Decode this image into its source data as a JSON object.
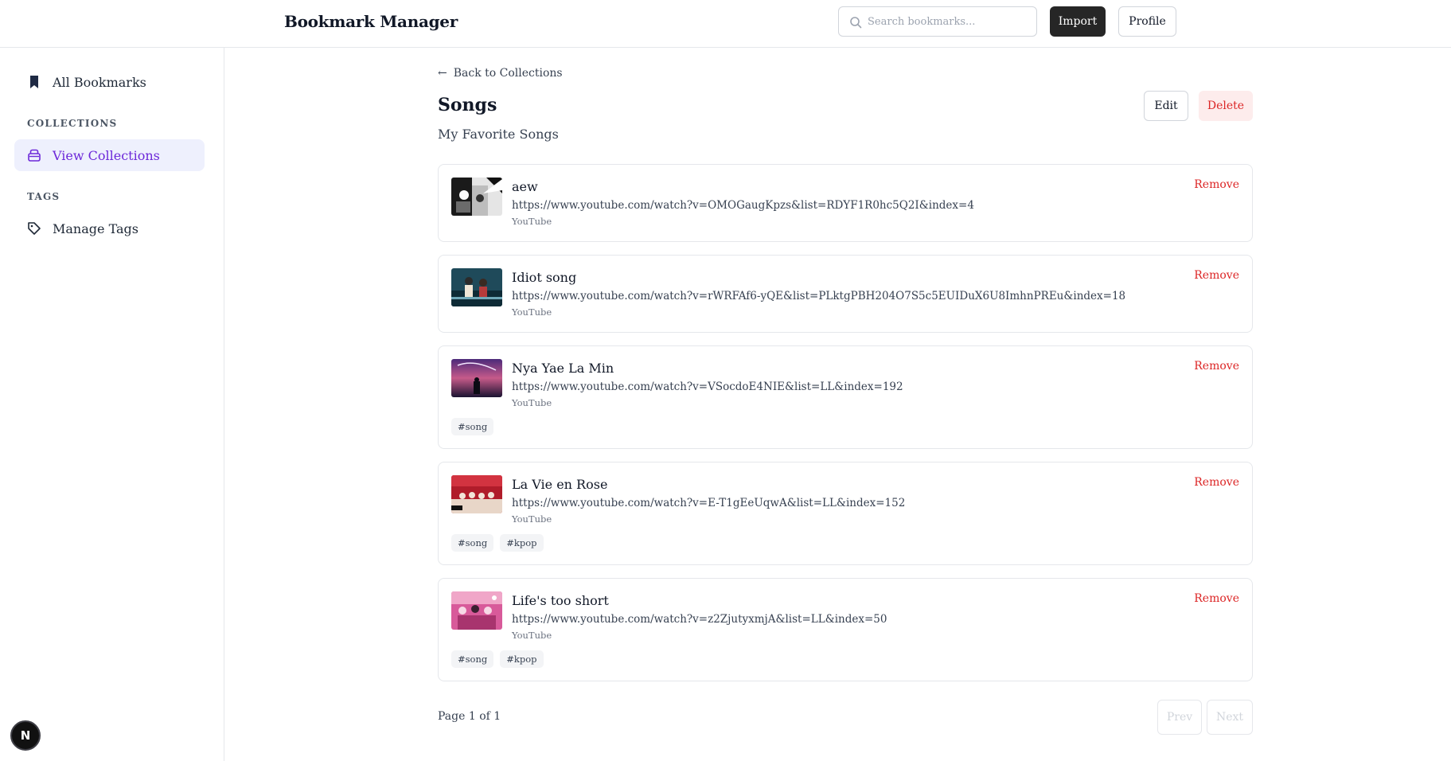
{
  "header": {
    "brand": "Bookmark Manager",
    "search_placeholder": "Search bookmarks...",
    "import_label": "Import",
    "profile_label": "Profile"
  },
  "sidebar": {
    "all_bookmarks": "All Bookmarks",
    "collections_heading": "COLLECTIONS",
    "view_collections": "View Collections",
    "tags_heading": "TAGS",
    "manage_tags": "Manage Tags"
  },
  "main": {
    "back_label": "Back to Collections",
    "back_arrow": "←",
    "title": "Songs",
    "subtitle": "My Favorite Songs",
    "edit_label": "Edit",
    "delete_label": "Delete",
    "bookmarks": [
      {
        "title": "aew",
        "url": "https://www.youtube.com/watch?v=OMOGaugKpzs&list=RDYF1R0hc5Q2I&index=4",
        "source": "YouTube",
        "remove": "Remove",
        "tags": []
      },
      {
        "title": "Idiot song",
        "url": "https://www.youtube.com/watch?v=rWRFAf6-yQE&list=PLktgPBH204O7S5c5EUIDuX6U8ImhnPREu&index=18",
        "source": "YouTube",
        "remove": "Remove",
        "tags": []
      },
      {
        "title": "Nya Yae La Min",
        "url": "https://www.youtube.com/watch?v=VSocdoE4NIE&list=LL&index=192",
        "source": "YouTube",
        "remove": "Remove",
        "tags": [
          "#song"
        ]
      },
      {
        "title": "La Vie en Rose",
        "url": "https://www.youtube.com/watch?v=E-T1gEeUqwA&list=LL&index=152",
        "source": "YouTube",
        "remove": "Remove",
        "tags": [
          "#song",
          "#kpop"
        ]
      },
      {
        "title": "Life's too short",
        "url": "https://www.youtube.com/watch?v=z2ZjutyxmjA&list=LL&index=50",
        "source": "YouTube",
        "remove": "Remove",
        "tags": [
          "#song",
          "#kpop"
        ]
      }
    ],
    "pagination": {
      "info": "Page 1 of 1",
      "prev": "Prev",
      "next": "Next"
    }
  },
  "badge": {
    "letter": "N"
  },
  "colors": {
    "accent": "#6d28d9",
    "danger": "#dc2626",
    "primary_button": "#262626"
  }
}
